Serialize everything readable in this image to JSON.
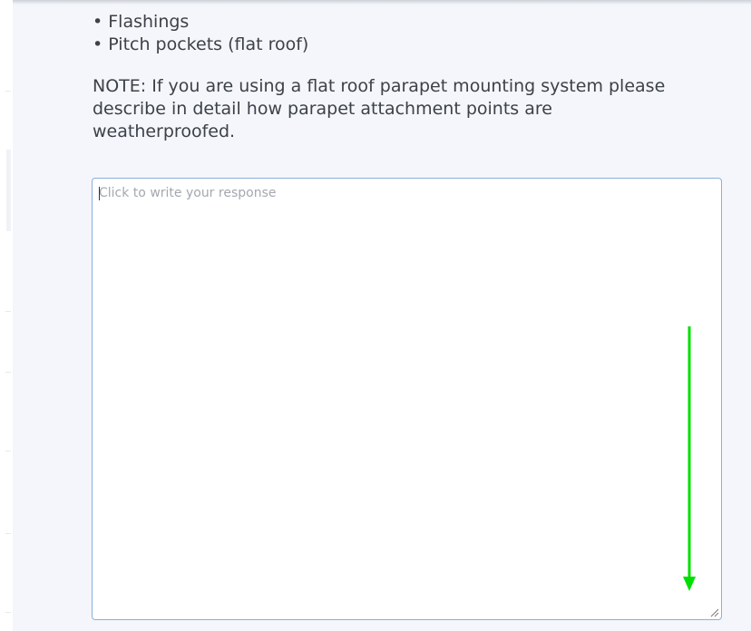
{
  "question": {
    "bullets": [
      "• Flashings",
      "• Pitch pockets (flat roof)"
    ],
    "note": "NOTE: If you are using a flat roof parapet mounting system please describe in detail how parapet attachment points are weatherproofed."
  },
  "response": {
    "placeholder": "Click to write your response"
  },
  "icons": {
    "resize": "resize-grip-icon",
    "annotation": "arrow-down-icon"
  },
  "colors": {
    "panel_background": "#f4f6fb",
    "text": "#3d4148",
    "input_border": "#8ab0dc",
    "annotation_arrow": "#00e000"
  }
}
